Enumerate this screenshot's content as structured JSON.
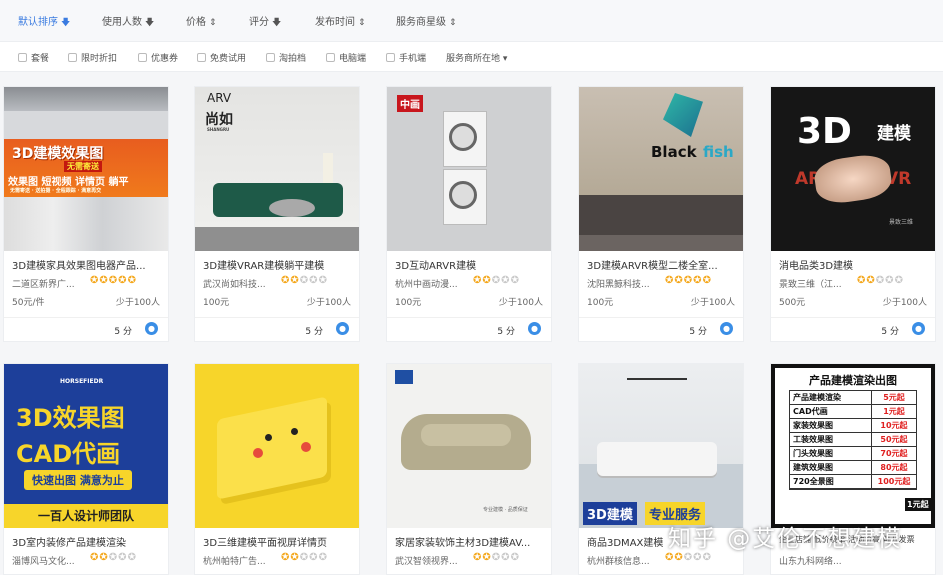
{
  "sort": {
    "items": [
      {
        "label": "默认排序",
        "arrow": "🡇"
      },
      {
        "label": "使用人数",
        "arrow": "🡇"
      },
      {
        "label": "价格",
        "arrow": "⇕"
      },
      {
        "label": "评分",
        "arrow": "🡇"
      },
      {
        "label": "发布时间",
        "arrow": "⇕"
      },
      {
        "label": "服务商星级",
        "arrow": "⇕"
      }
    ]
  },
  "filters": {
    "items": [
      "套餐",
      "限时折扣",
      "优惠券",
      "免费试用",
      "淘拍档",
      "电脑端",
      "手机端"
    ],
    "location_label": "服务商所在地",
    "location_arrow": "▾"
  },
  "cards": [
    {
      "title": "3D建模家具效果图电器产品...",
      "shop": "二道区新界广...",
      "rating": 5,
      "price": "50元/件",
      "sales": "少于100人",
      "score": "5 分",
      "thumb_text": {
        "t1": "3D建模效果图",
        "t2": "无需寄送",
        "t3": "效果图 短视频 详情页 躺平",
        "t4": "无需寄送 · 送拍摄 · 全程跟踪 · 满意再交"
      }
    },
    {
      "title": "3D建模VRAR建模躺平建模",
      "shop": "武汉尚如科技...",
      "rating": 2,
      "price": "100元",
      "sales": "少于100人",
      "score": "5 分",
      "thumb_text": {
        "t1": "ARV",
        "t2": "尚如",
        "t3": "SHANGRU"
      }
    },
    {
      "title": "3D互动ARVR建模",
      "shop": "杭州中画动漫...",
      "rating": 2,
      "price": "100元",
      "sales": "少于100人",
      "score": "5 分",
      "thumb_text": {
        "t1": "中画"
      }
    },
    {
      "title": "3D建模ARVR模型二楼全室...",
      "shop": "沈阳黑鲸科技...",
      "rating": 5,
      "price": "100元",
      "sales": "少于100人",
      "score": "5 分",
      "thumb_text": {
        "t1": "Black",
        "t2": "fish"
      }
    },
    {
      "title": "消电品类3D建模",
      "shop": "景致三维（江...",
      "rating": 2,
      "price": "500元",
      "sales": "少于100人",
      "score": "5 分",
      "thumb_text": {
        "t1": "3D",
        "t2": "建模",
        "t3": "AR",
        "t4": "VR",
        "t5": "景致三维"
      }
    },
    {
      "title": "3D室内装修产品建模渲染",
      "shop": "淄博风马文化...",
      "rating": 2,
      "thumb_text": {
        "t1": "HORSEFIEDR",
        "t2": "3D效果图",
        "t3": "CAD代画",
        "t4": "快速出图 满意为止",
        "t5": "一百人设计师团队"
      }
    },
    {
      "title": "3D三维建模平面视屏详情页",
      "shop": "杭州帕特广告...",
      "rating": 2,
      "thumb_text": {}
    },
    {
      "title": "家居家装软饰主材3D建模AV...",
      "shop": "武汉智领视界...",
      "rating": 2,
      "thumb_text": {
        "t1": "专业建模 · 品质保证"
      }
    },
    {
      "title": "商品3DMAX建模",
      "shop": "杭州群核信息...",
      "rating": 2,
      "thumb_text": {
        "t1": "3D建模",
        "t2": "专业服务"
      }
    },
    {
      "title": "企业店铺 低价接单 活动价高 可开发票",
      "shop": "山东九科网络...",
      "rating": 0,
      "thumb_text": {
        "title": "产品建模渲染出图",
        "rows": [
          [
            "产品建模渲染",
            "5元起"
          ],
          [
            "CAD代画",
            "1元起"
          ],
          [
            "家装效果图",
            "10元起"
          ],
          [
            "工装效果图",
            "50元起"
          ],
          [
            "门头效果图",
            "70元起"
          ],
          [
            "建筑效果图",
            "80元起"
          ],
          [
            "720全景图",
            "100元起"
          ]
        ],
        "corner": "1元起"
      }
    }
  ],
  "watermark": "知乎 @艾伦不想建模",
  "colors": {
    "accent": "#3a7be0",
    "star": "#f4a81e",
    "red": "#e02020",
    "yellow": "#f7d52a",
    "navy": "#1d3f9a"
  }
}
